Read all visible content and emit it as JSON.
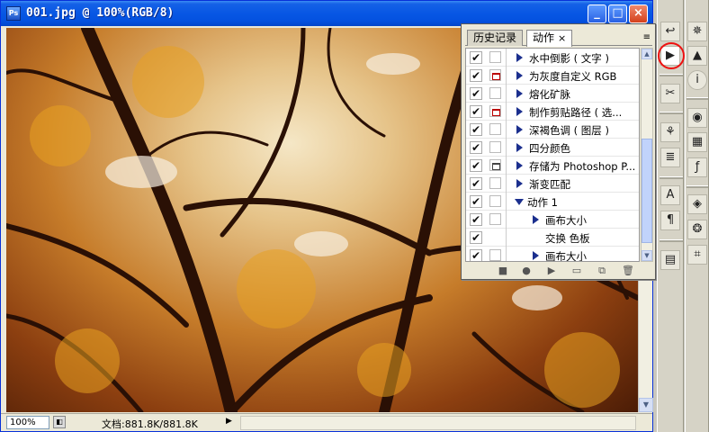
{
  "window": {
    "title": "001.jpg @ 100%(RGB/8)",
    "app_icon": "Ps",
    "minimize": "_",
    "maximize": "□",
    "close": "×"
  },
  "status_bar": {
    "zoom": "100%",
    "doc_info": "文档:881.8K/881.8K",
    "arrow": "▶"
  },
  "panel": {
    "tabs": [
      {
        "label": "历史记录"
      },
      {
        "label": "动作",
        "close": "×"
      }
    ],
    "menu_icon": "≡",
    "rows": [
      {
        "checked": "✔",
        "label": "水中倒影 ( 文字 )",
        "dialog": "off",
        "expander": "right",
        "indent": 0
      },
      {
        "checked": "✔",
        "label": "为灰度自定义 RGB",
        "dialog": "red",
        "expander": "right",
        "indent": 0
      },
      {
        "checked": "✔",
        "label": "熔化矿脉",
        "dialog": "off",
        "expander": "right",
        "indent": 0
      },
      {
        "checked": "✔",
        "label": "制作剪贴路径 ( 选...",
        "dialog": "red",
        "expander": "right",
        "indent": 0
      },
      {
        "checked": "✔",
        "label": "深褐色调 ( 图层 )",
        "dialog": "off",
        "expander": "right",
        "indent": 0
      },
      {
        "checked": "✔",
        "label": "四分颜色",
        "dialog": "off",
        "expander": "right",
        "indent": 0
      },
      {
        "checked": "✔",
        "label": "存储为 Photoshop P...",
        "dialog": "dark",
        "expander": "right",
        "indent": 0
      },
      {
        "checked": "✔",
        "label": "渐变匹配",
        "dialog": "off",
        "expander": "right",
        "indent": 0
      },
      {
        "checked": "✔",
        "label": "动作 1",
        "dialog": "off",
        "expander": "down",
        "indent": 0
      },
      {
        "checked": "✔",
        "label": "画布大小",
        "dialog": "off",
        "expander": "right",
        "indent": 1
      },
      {
        "checked": "✔",
        "label": "交换 色板",
        "dialog": "none",
        "expander": "none",
        "indent": 1
      },
      {
        "checked": "✔",
        "label": "画布大小",
        "dialog": "off",
        "expander": "right",
        "indent": 1
      }
    ],
    "footer": [
      "stop-icon",
      "record-icon",
      "play-icon",
      "new-set-icon",
      "new-action-icon",
      "trash-icon"
    ]
  },
  "colors": {
    "title_blue": "#0757e4",
    "highlight_ring": "#e11111",
    "expander_triangle": "#1b2f8e"
  },
  "tools_strip1": [
    "history-brush-icon",
    "actions-play-icon",
    "tool-presets-icon",
    "clone-source-icon",
    "stamp-icon",
    "character-icon",
    "paragraph-icon",
    "notes-icon"
  ],
  "tools_strip2": [
    "navigator-icon",
    "histogram-icon",
    "info-icon",
    "color-icon",
    "swatches-icon",
    "styles-icon",
    "layers-icon",
    "channels-icon",
    "paths-icon"
  ]
}
